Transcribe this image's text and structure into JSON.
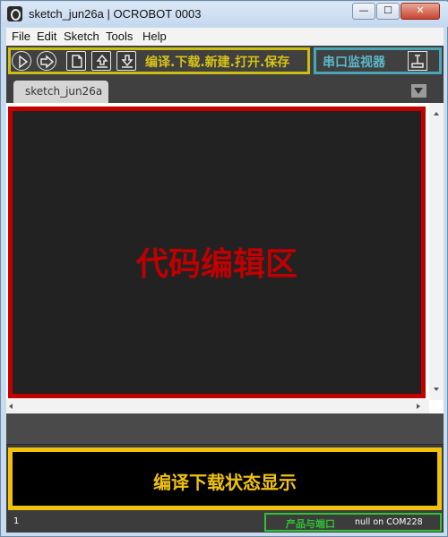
{
  "window": {
    "title": "sketch_jun26a | OCROBOT 0003",
    "controls": {
      "minimize": "—",
      "maximize": "☐",
      "close": "✕"
    }
  },
  "menu": [
    "File",
    "Edit",
    "Sketch",
    "Tools",
    "Help"
  ],
  "toolbar": {
    "buttons": [
      "verify",
      "upload",
      "new",
      "open",
      "save"
    ],
    "annotation": "编译.下载.新建.打开.保存",
    "serial_annotation": "串口监视器"
  },
  "tabs": [
    {
      "label": "sketch_jun26a",
      "active": true
    }
  ],
  "editor": {
    "annotation": "代码编辑区"
  },
  "console": {
    "annotation": "编译下载状态显示"
  },
  "status": {
    "line": "1",
    "product_annotation": "产品与端口",
    "port": "null on COM228"
  },
  "colors": {
    "toolbar_annotation": "#d6c314",
    "serial_annotation": "#5ab8c8",
    "editor_annotation": "#c00000",
    "console_annotation": "#f0c20e",
    "status_annotation": "#2ec234"
  }
}
